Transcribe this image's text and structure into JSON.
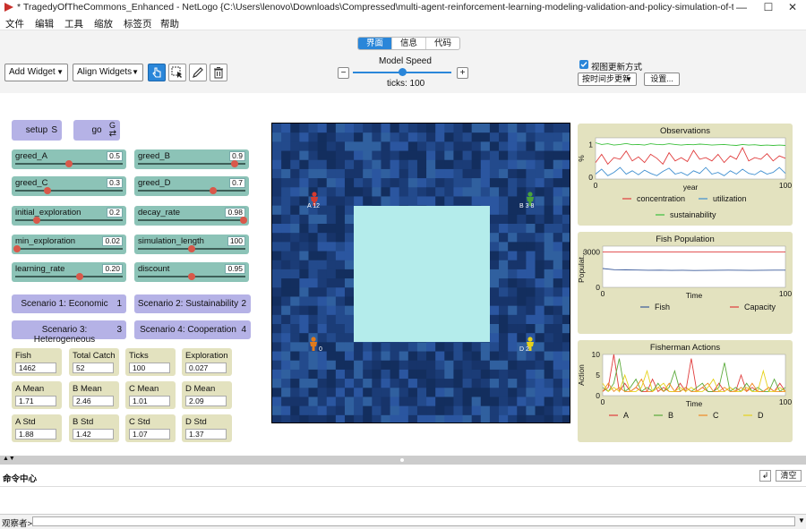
{
  "window": {
    "title": "* TragedyOfTheCommons_Enhanced - NetLogo {C:\\Users\\lenovo\\Downloads\\Compressed\\multi-agent-reinforcement-learning-modeling-validation-and-policy-simulation-of-the-tragedy-of-the-commons-",
    "minimize": "—",
    "maximize": "☐",
    "close": "✕"
  },
  "menu": [
    "文件",
    "编辑",
    "工具",
    "缩放",
    "标签页",
    "帮助"
  ],
  "tabs": [
    {
      "label": "界面",
      "active": true
    },
    {
      "label": "信息",
      "active": false
    },
    {
      "label": "代码",
      "active": false
    }
  ],
  "toolbar": {
    "add_widget": "Add Widget",
    "align_widgets": "Align Widgets",
    "model_speed_label": "Model Speed",
    "ticks_label": "ticks: 100",
    "speed_level": 0.5,
    "view_updates_label": "视图更新方式",
    "view_updates_checked": true,
    "update_mode": "按时间步更新",
    "settings": "设置...",
    "minus": "−",
    "plus": "+"
  },
  "buttons": {
    "setup": {
      "label": "setup",
      "key": "S"
    },
    "go": {
      "label": "go",
      "key": "G"
    },
    "scenario1": {
      "label": "Scenario 1: Economic",
      "key": "1"
    },
    "scenario2": {
      "label": "Scenario 2: Sustainability",
      "key": "2"
    },
    "scenario3": {
      "label": "Scenario 3: Heterogeneous",
      "key": "3"
    },
    "scenario4": {
      "label": "Scenario 4: Cooperation",
      "key": "4"
    }
  },
  "sliders": [
    {
      "name": "greed_A",
      "value": "0.5",
      "level": 0.5
    },
    {
      "name": "greed_B",
      "value": "0.9",
      "level": 0.9
    },
    {
      "name": "greed_C",
      "value": "0.3",
      "level": 0.3
    },
    {
      "name": "greed_D",
      "value": "0.7",
      "level": 0.7
    },
    {
      "name": "initial_exploration",
      "value": "0.2",
      "level": 0.2
    },
    {
      "name": "decay_rate",
      "value": "0.98",
      "level": 0.98
    },
    {
      "name": "min_exploration",
      "value": "0.02",
      "level": 0.02
    },
    {
      "name": "simulation_length",
      "value": "100",
      "level": 0.5
    },
    {
      "name": "learning_rate",
      "value": "0.20",
      "level": 0.6
    },
    {
      "name": "discount",
      "value": "0.95",
      "level": 0.5
    }
  ],
  "monitors": [
    {
      "label": "Fish",
      "value": "1462"
    },
    {
      "label": "Total Catch",
      "value": "52"
    },
    {
      "label": "Ticks",
      "value": "100"
    },
    {
      "label": "Exploration",
      "value": "0.027"
    },
    {
      "label": "A Mean",
      "value": "1.71"
    },
    {
      "label": "B Mean",
      "value": "2.46"
    },
    {
      "label": "C Mean",
      "value": "1.01"
    },
    {
      "label": "D Mean",
      "value": "2.09"
    },
    {
      "label": "A Std",
      "value": "1.88"
    },
    {
      "label": "B Std",
      "value": "1.42"
    },
    {
      "label": "C Std",
      "value": "1.07"
    },
    {
      "label": "D Std",
      "value": "1.37"
    }
  ],
  "world": {
    "agents": [
      {
        "id": "A",
        "label": "A 12",
        "color": "#d63a2f"
      },
      {
        "id": "B",
        "label": "B 3 8",
        "color": "#4aa33a"
      },
      {
        "id": "C",
        "label": "0",
        "color": "#e07a1c"
      },
      {
        "id": "D",
        "label": "D 2",
        "color": "#e6d21c"
      }
    ],
    "pond_color": "#b4eceb"
  },
  "chart_data": [
    {
      "type": "line",
      "title": "Observations",
      "xlabel": "year",
      "ylabel": "%",
      "xlim": [
        0,
        100
      ],
      "y_ticks": [
        "1",
        "0"
      ],
      "x_ticks": [
        "0",
        "100"
      ],
      "series": [
        {
          "name": "concentration",
          "color": "#e03c3c",
          "values": [
            0.45,
            0.7,
            0.4,
            0.6,
            0.55,
            0.8,
            0.5,
            0.62,
            0.45,
            0.7,
            0.58,
            0.4,
            0.75,
            0.5,
            0.6,
            0.48,
            0.82,
            0.55,
            0.6,
            0.5,
            0.7,
            0.45,
            0.65,
            0.55,
            0.9,
            0.5,
            0.6,
            0.55,
            0.72,
            0.5,
            0.65,
            0.58
          ]
        },
        {
          "name": "utilization",
          "color": "#3f8fd0",
          "values": [
            0.1,
            0.25,
            0.05,
            0.15,
            0.3,
            0.1,
            0.2,
            0.08,
            0.22,
            0.12,
            0.05,
            0.18,
            0.28,
            0.1,
            0.15,
            0.06,
            0.2,
            0.12,
            0.3,
            0.1,
            0.15,
            0.05,
            0.2,
            0.1,
            0.25,
            0.12,
            0.08,
            0.2,
            0.1,
            0.15,
            0.3,
            0.12
          ]
        },
        {
          "name": "sustainability",
          "color": "#3bbf3b",
          "values": [
            1.05,
            1.0,
            1.02,
            0.98,
            1.0,
            1.03,
            0.99,
            1.0,
            0.98,
            1.02,
            1.0,
            0.99,
            1.02,
            1.0,
            0.98,
            1.0,
            0.99,
            1.01,
            1.0,
            0.98,
            0.99,
            1.0,
            0.98,
            0.97,
            1.0,
            0.98,
            0.99,
            0.97,
            0.98,
            0.97,
            0.98,
            0.97
          ]
        }
      ],
      "legend": "bottom"
    },
    {
      "type": "line",
      "title": "Fish Population",
      "xlabel": "Time",
      "ylabel": "Populat...",
      "xlim": [
        0,
        100
      ],
      "ylim": [
        0,
        3500
      ],
      "y_ticks": [
        "3000",
        "0"
      ],
      "x_ticks": [
        "0",
        "100"
      ],
      "series": [
        {
          "name": "Fish",
          "color": "#3a5a9a",
          "values": [
            1600,
            1500,
            1480,
            1470,
            1450,
            1460,
            1440,
            1450,
            1430,
            1440,
            1450,
            1460,
            1450,
            1440,
            1450,
            1460,
            1462
          ]
        },
        {
          "name": "Capacity",
          "color": "#e03c3c",
          "values": [
            3000,
            3000,
            3000,
            3000,
            3000,
            3000,
            3000,
            3000,
            3000,
            3000,
            3000,
            3000,
            3000,
            3000,
            3000,
            3000,
            3000
          ]
        }
      ],
      "legend": "bottom"
    },
    {
      "type": "line",
      "title": "Fisherman Actions",
      "xlabel": "Time",
      "ylabel": "Action",
      "xlim": [
        0,
        100
      ],
      "ylim": [
        0,
        10
      ],
      "y_ticks": [
        "10",
        "5",
        "0"
      ],
      "x_ticks": [
        "0",
        "100"
      ],
      "series": [
        {
          "name": "A",
          "color": "#e03c3c",
          "values": [
            1,
            2,
            10,
            1,
            3,
            1,
            2,
            1,
            1,
            4,
            1,
            2,
            1,
            1,
            3,
            1,
            9,
            1,
            2,
            1,
            1,
            3,
            1,
            2,
            1,
            5,
            1,
            2,
            1,
            1,
            2,
            1,
            3,
            1
          ]
        },
        {
          "name": "B",
          "color": "#5aaa3a",
          "values": [
            2,
            1,
            3,
            9,
            1,
            2,
            4,
            1,
            2,
            1,
            3,
            1,
            2,
            6,
            1,
            2,
            1,
            2,
            3,
            1,
            1,
            2,
            8,
            1,
            2,
            1,
            3,
            1,
            2,
            1,
            1,
            4,
            1,
            2
          ]
        },
        {
          "name": "C",
          "color": "#f08a24",
          "values": [
            1,
            3,
            1,
            2,
            1,
            1,
            2,
            4,
            1,
            1,
            2,
            1,
            3,
            1,
            1,
            2,
            1,
            1,
            2,
            3,
            1,
            1,
            2,
            1,
            1,
            2,
            1,
            3,
            1,
            1,
            2,
            1,
            1,
            1
          ]
        },
        {
          "name": "D",
          "color": "#e6d21c",
          "values": [
            3,
            1,
            2,
            1,
            5,
            1,
            1,
            2,
            6,
            1,
            2,
            3,
            1,
            1,
            2,
            1,
            2,
            1,
            1,
            2,
            4,
            1,
            1,
            2,
            1,
            1,
            2,
            1,
            1,
            6,
            1,
            1,
            2,
            1
          ]
        }
      ],
      "legend": "bottom"
    }
  ],
  "command_center": {
    "title": "命令中心",
    "clear": "清空",
    "prompt": "观察者>"
  }
}
